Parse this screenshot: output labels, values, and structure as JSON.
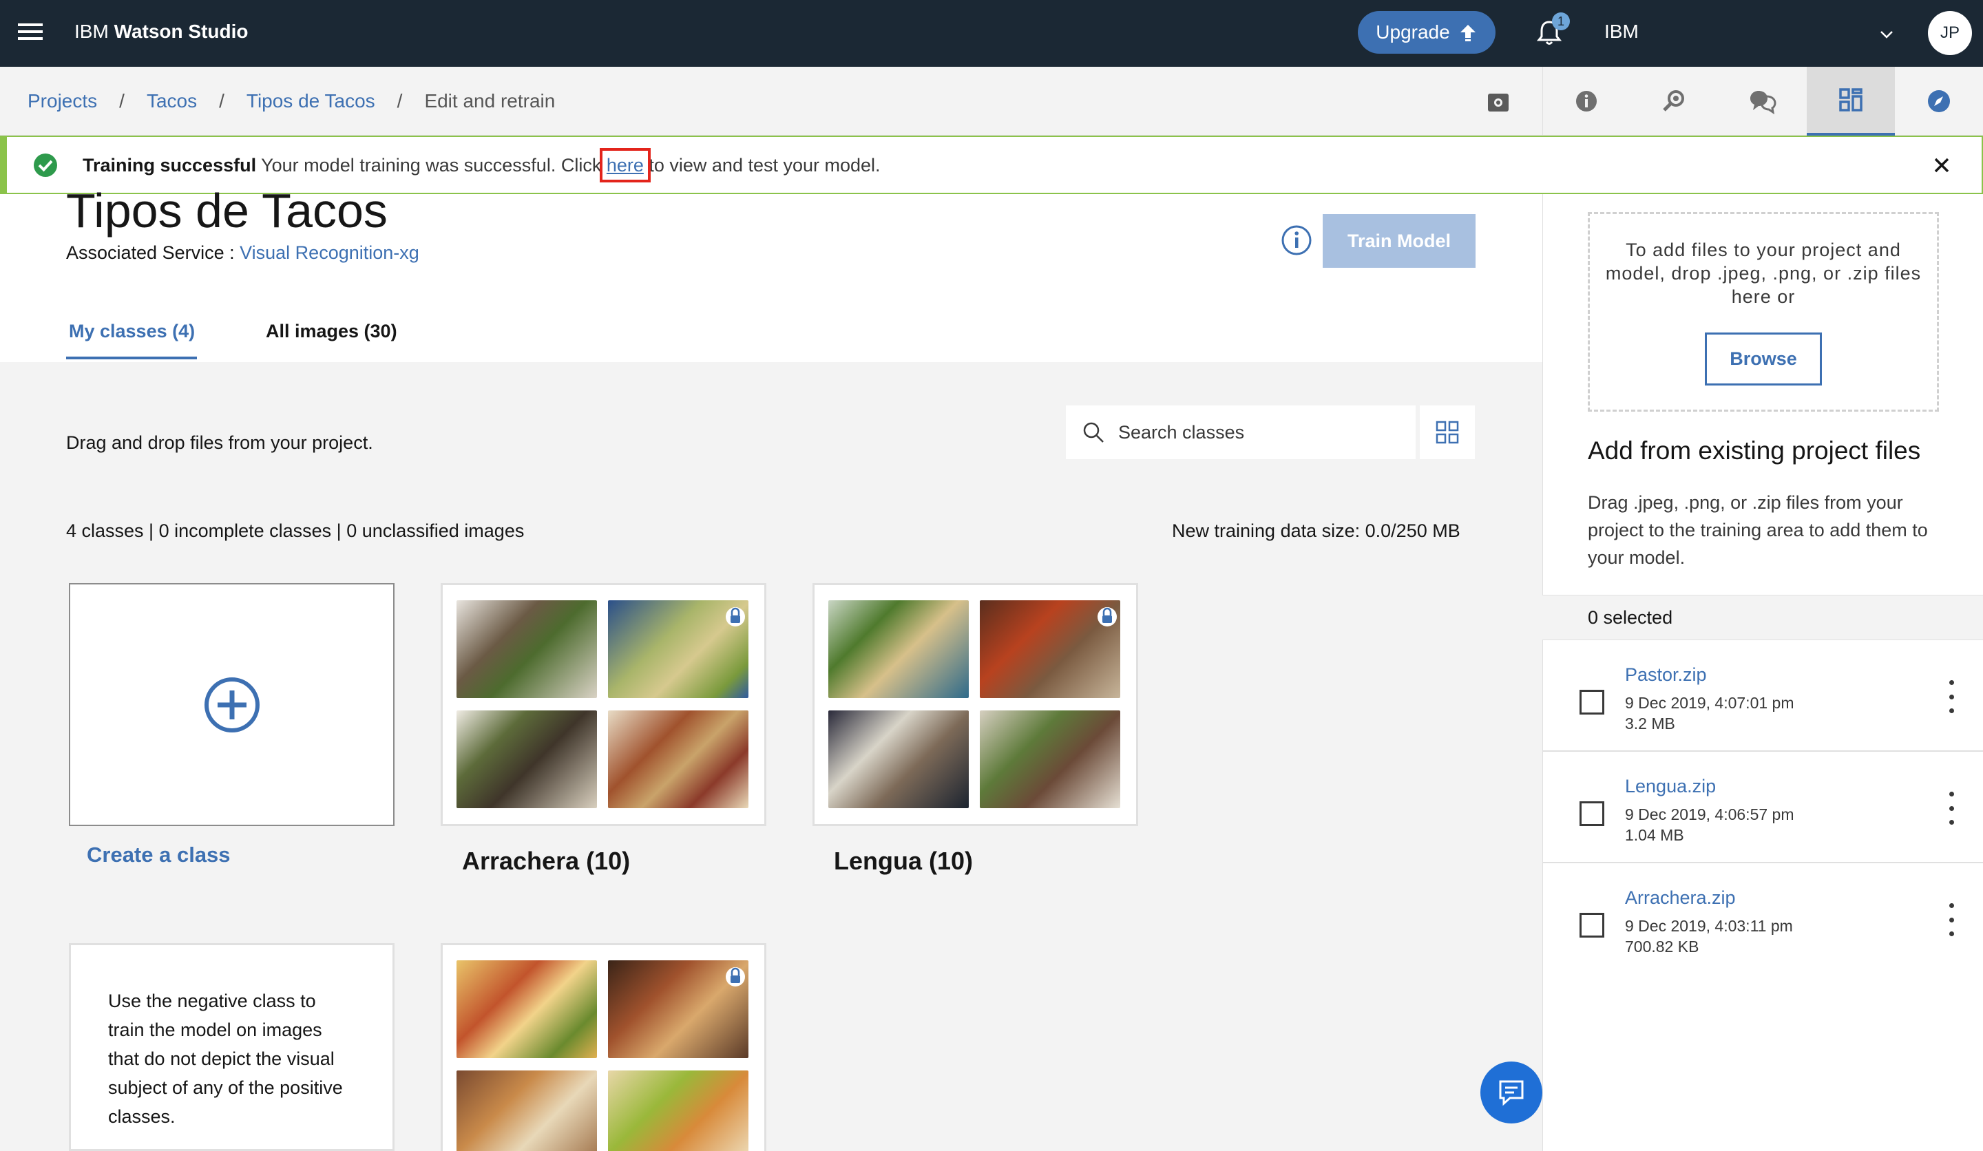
{
  "header": {
    "brand_prefix": "IBM",
    "brand_name": "Watson Studio",
    "upgrade_label": "Upgrade",
    "notification_count": "1",
    "account_name": "IBM",
    "avatar_initials": "JP"
  },
  "breadcrumb": {
    "items": [
      "Projects",
      "Tacos",
      "Tipos de Tacos"
    ],
    "separator": "/",
    "current": "Edit and retrain"
  },
  "notification": {
    "title": "Training successful",
    "message_before": "Your model training was successful. Click ",
    "link_text": "here",
    "message_after": " to view and test your model."
  },
  "model": {
    "title": "Tipos de Tacos",
    "service_label": "Associated Service :",
    "service_name": "Visual Recognition-xg",
    "train_button": "Train Model"
  },
  "tabs": [
    "My classes (4)",
    "All images (30)"
  ],
  "main": {
    "drag_text": "Drag and drop files from your project.",
    "search_placeholder": "Search classes",
    "stats": "4 classes | 0 incomplete classes | 0 unclassified images",
    "data_size": "New training data size: 0.0/250 MB",
    "create_label": "Create a class",
    "classes": [
      {
        "label": "Arrachera (10)"
      },
      {
        "label": "Lengua (10)"
      }
    ],
    "negative_text": "Use the negative class to train the model on images that do not depict the visual subject of any of the positive classes."
  },
  "right_panel": {
    "dropzone_text": "To add files to your project and model, drop .jpeg, .png, or .zip files here or",
    "browse_label": "Browse",
    "add_existing_title": "Add from existing project files",
    "add_existing_desc": "Drag .jpeg, .png, or .zip files from your project to the training area to add them to your model.",
    "selected_text": "0 selected",
    "files": [
      {
        "name": "Pastor.zip",
        "date": "9 Dec 2019, 4:07:01 pm",
        "size": "3.2 MB"
      },
      {
        "name": "Lengua.zip",
        "date": "9 Dec 2019, 4:06:57 pm",
        "size": "1.04 MB"
      },
      {
        "name": "Arrachera.zip",
        "date": "9 Dec 2019, 4:03:11 pm",
        "size": "700.82 KB"
      }
    ]
  },
  "icons": {
    "menu": "hamburger-menu-icon",
    "upgrade": "upload-arrow-icon",
    "notifications": "bell-icon",
    "account": "chevron-down-icon",
    "crumb_action": "camera-icon",
    "nav": [
      "info-icon",
      "search-model-icon",
      "chat-bubbles-icon",
      "dashboard-icon",
      "compass-icon"
    ],
    "success": "checkmark-filled-icon",
    "close": "close-icon",
    "search": "search-icon",
    "grid_view": "grid-view-icon",
    "create": "add-circle-icon",
    "lock": "lock-icon",
    "chat": "chat-icon"
  },
  "colors": {
    "header_bg": "#1b2834",
    "accent": "#3d70b2",
    "success": "#8bc34a",
    "train_disabled": "#a8c0e0",
    "highlight": "#e3241b"
  }
}
